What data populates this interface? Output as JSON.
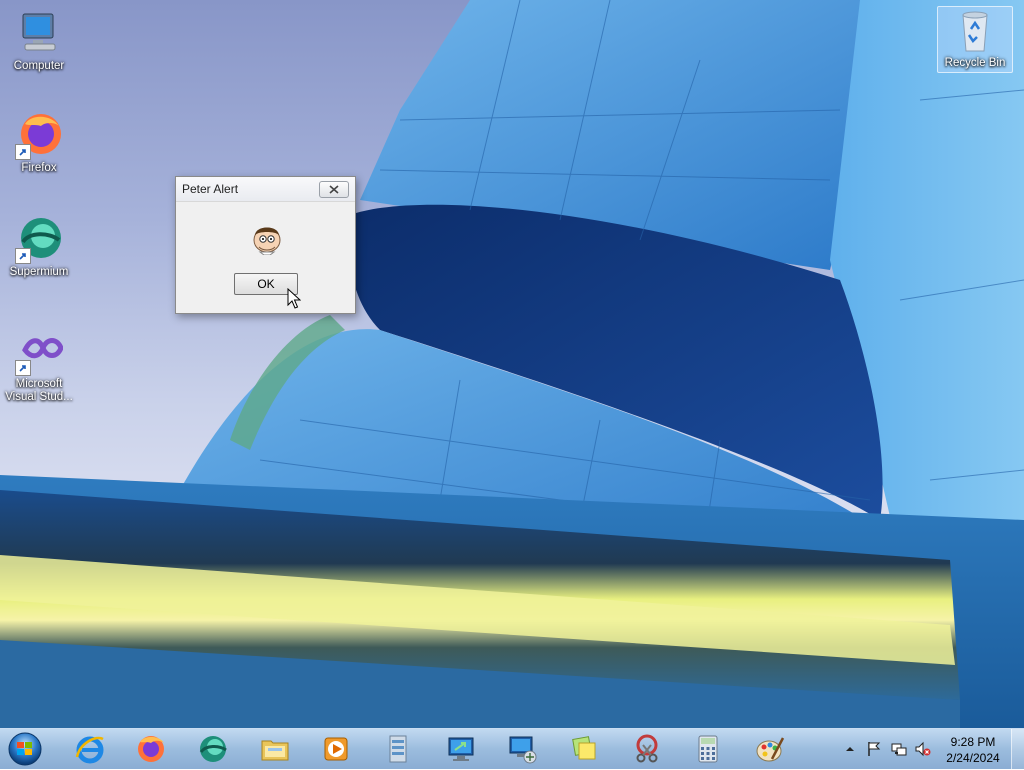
{
  "desktop": {
    "icons": [
      {
        "label": "Computer",
        "icon": "computer-icon"
      },
      {
        "label": "Firefox",
        "icon": "firefox-icon"
      },
      {
        "label": "Supermium",
        "icon": "supermium-icon"
      },
      {
        "label": "Microsoft Visual Stud...",
        "icon": "visual-studio-icon"
      },
      {
        "label": "Recycle Bin",
        "icon": "recycle-bin-icon"
      }
    ]
  },
  "dialog": {
    "title": "Peter Alert",
    "image": "peter-face-icon",
    "ok_label": "OK"
  },
  "taskbar": {
    "pinned": [
      "internet-explorer-icon",
      "firefox-icon",
      "supermium-icon",
      "file-explorer-icon",
      "media-player-icon",
      "file-manager-icon",
      "remote-desktop-icon",
      "network-computer-icon",
      "sticky-notes-icon",
      "snipping-tool-icon",
      "calculator-icon",
      "paint-icon"
    ],
    "tray": {
      "icons": [
        "show-hidden-icons-icon",
        "action-center-flag-icon",
        "network-icon",
        "volume-muted-icon"
      ]
    },
    "clock": {
      "time": "9:28 PM",
      "date": "2/24/2024"
    }
  },
  "colors": {
    "sky": "#a6b2da",
    "building_blue": "#3f8fd6",
    "taskbar": "#9dbbdf",
    "dialog_bg": "#f0f0f0"
  }
}
